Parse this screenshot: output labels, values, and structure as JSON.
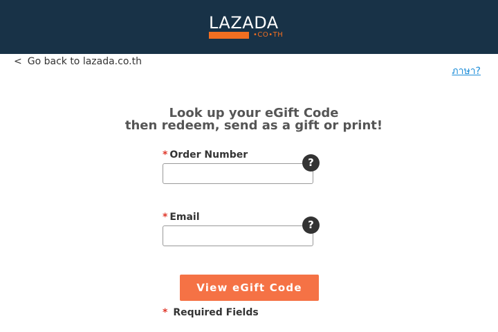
{
  "header": {
    "logo_text": "LAZADA",
    "logo_domain": "•CO•TH",
    "brand_color": "#f36f21",
    "bar_color": "#183247"
  },
  "nav": {
    "back_chevron": "<",
    "back_label": "Go back to lazada.co.th",
    "language_label": "ภาษา?"
  },
  "form": {
    "title_line1": "Look up your eGift Code",
    "title_line2": "then redeem, send as a gift or print!",
    "order_number_label": "Order Number",
    "order_number_value": "",
    "email_label": "Email",
    "email_value": "",
    "required_marker": "*",
    "help_icon": "?",
    "submit_label": "View eGift Code",
    "required_fields_note": "Required Fields",
    "button_color": "#f57245"
  }
}
